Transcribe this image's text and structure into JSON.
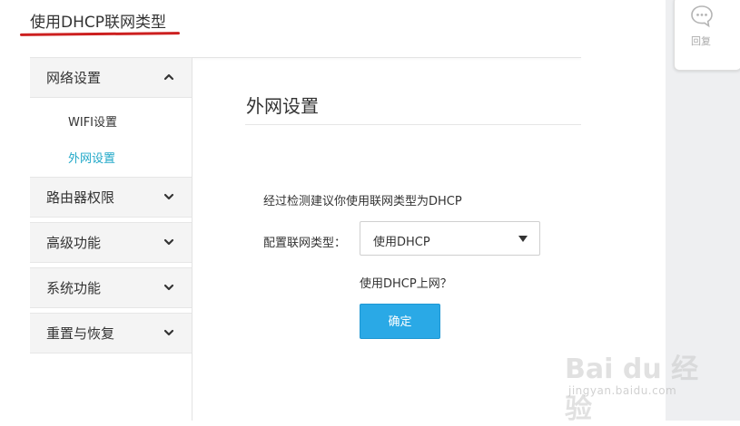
{
  "page": {
    "title": "使用DHCP联网类型"
  },
  "side_panel": {
    "reply_label": "回复",
    "reply_icon": "comment-bubble-icon"
  },
  "sidebar": {
    "groups": [
      {
        "label": "网络设置",
        "expanded": true,
        "icon": "chevron-up-icon"
      },
      {
        "label": "路由器权限",
        "expanded": false,
        "icon": "chevron-down-icon"
      },
      {
        "label": "高级功能",
        "expanded": false,
        "icon": "chevron-down-icon"
      },
      {
        "label": "系统功能",
        "expanded": false,
        "icon": "chevron-down-icon"
      },
      {
        "label": "重置与恢复",
        "expanded": false,
        "icon": "chevron-down-icon"
      }
    ],
    "sub_items": [
      {
        "label": "WIFI设置",
        "active": false
      },
      {
        "label": "外网设置",
        "active": true
      }
    ]
  },
  "main": {
    "title": "外网设置",
    "hint": "经过检测建议你使用联网类型为DHCP",
    "conn_type_label": "配置联网类型：",
    "conn_type_value": "使用DHCP",
    "question": "使用DHCP上网？",
    "confirm_label": "确定"
  },
  "watermark": {
    "main": "Bai du 经验",
    "sub": "jingyan.baidu.com"
  },
  "colors": {
    "accent": "#20a8c8",
    "button": "#2aa9e6",
    "underline": "#cc1f1f"
  }
}
